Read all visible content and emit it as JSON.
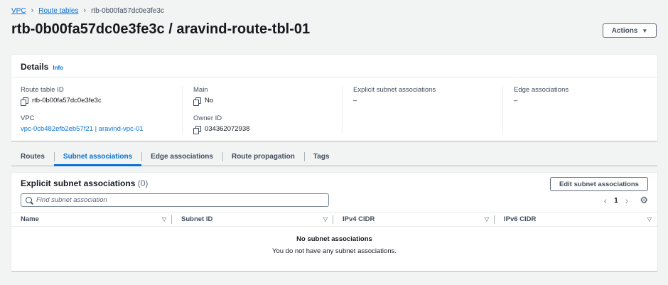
{
  "breadcrumb": {
    "items": [
      "VPC",
      "Route tables"
    ],
    "current": "rtb-0b00fa57dc0e3fe3c"
  },
  "header": {
    "title": "rtb-0b00fa57dc0e3fe3c / aravind-route-tbl-01",
    "actions_label": "Actions"
  },
  "details": {
    "title": "Details",
    "info_label": "Info",
    "route_table_id_label": "Route table ID",
    "route_table_id": "rtb-0b00fa57dc0e3fe3c",
    "main_label": "Main",
    "main_value": "No",
    "explicit_label": "Explicit subnet associations",
    "explicit_value": "–",
    "edge_label": "Edge associations",
    "edge_value": "–",
    "vpc_label": "VPC",
    "vpc_value": "vpc-0cb482efb2eb57f21 | aravind-vpc-01",
    "owner_label": "Owner ID",
    "owner_value": "034362072938"
  },
  "tabs": [
    {
      "label": "Routes"
    },
    {
      "label": "Subnet associations"
    },
    {
      "label": "Edge associations"
    },
    {
      "label": "Route propagation"
    },
    {
      "label": "Tags"
    }
  ],
  "active_tab": "Subnet associations",
  "subnet_panel": {
    "title": "Explicit subnet associations",
    "count": "(0)",
    "edit_label": "Edit subnet associations",
    "search_placeholder": "Find subnet association",
    "page": "1",
    "columns": [
      "Name",
      "Subnet ID",
      "IPv4 CIDR",
      "IPv6 CIDR"
    ],
    "empty_title": "No subnet associations",
    "empty_desc": "You do not have any subnet associations."
  },
  "icons": {
    "copy": "copy-icon",
    "search": "search-icon",
    "settings": "gear-icon",
    "sort": "sort-down-icon"
  },
  "colors": {
    "link": "#0972d3",
    "background": "#f2f3f3"
  }
}
